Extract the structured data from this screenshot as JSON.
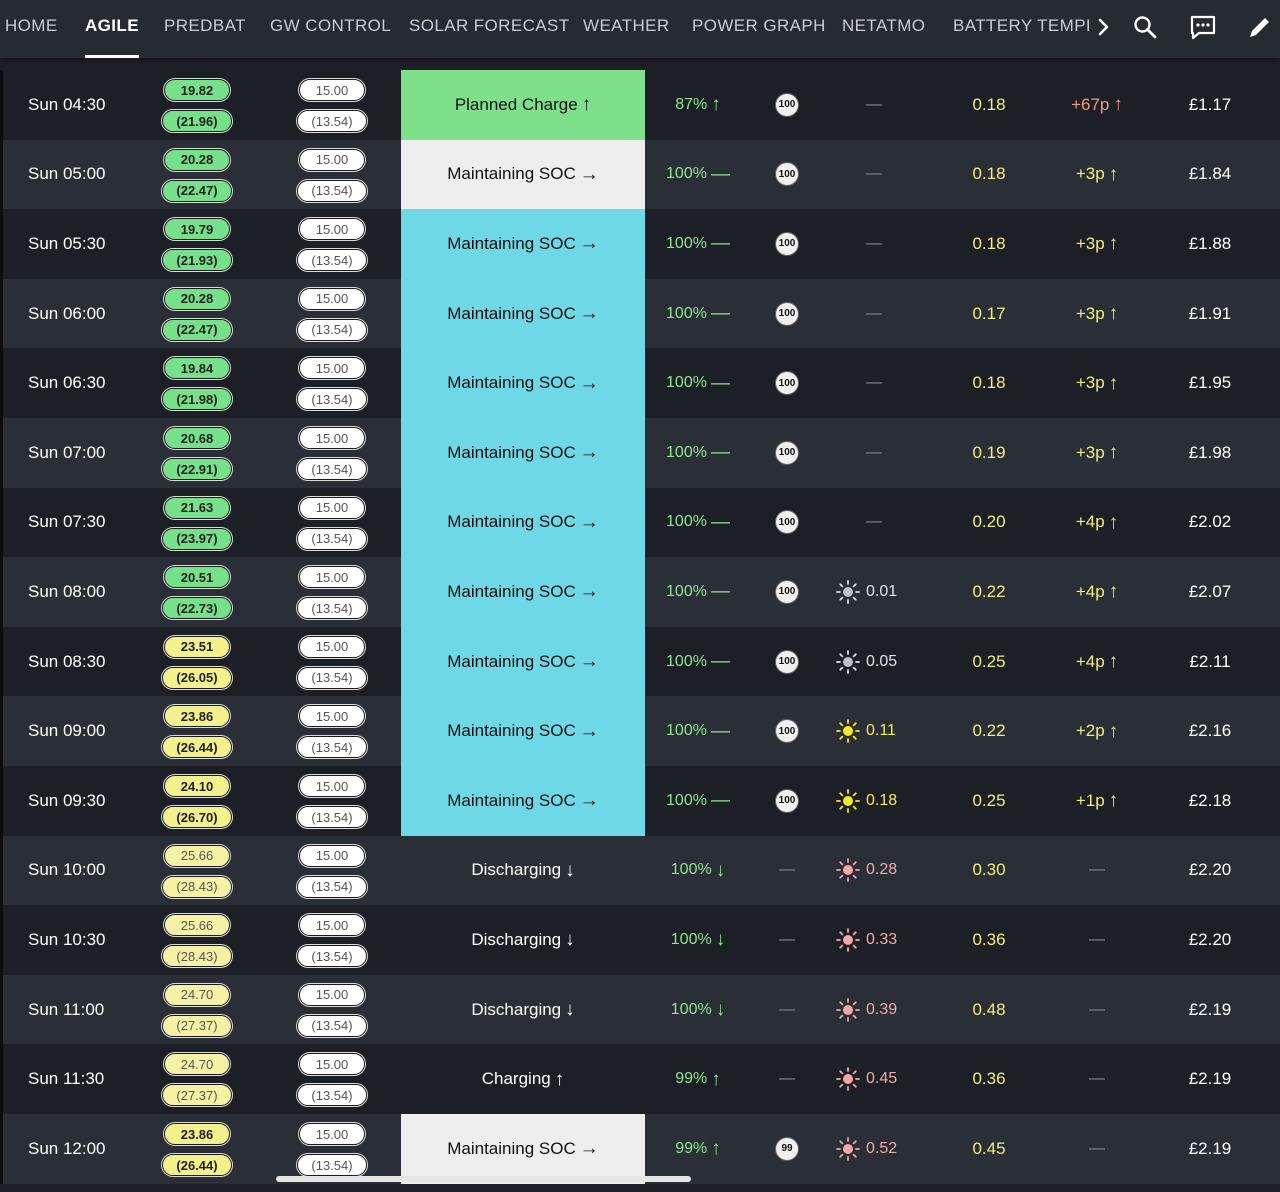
{
  "nav": {
    "tabs": [
      "HOME",
      "AGILE",
      "PREDBAT",
      "GW CONTROL",
      "SOLAR FORECAST",
      "WEATHER",
      "POWER GRAPH",
      "NETATMO",
      "BATTERY TEMPER"
    ],
    "active_tab": "AGILE",
    "icons": [
      "chevron-right-icon",
      "search-icon",
      "chat-icon",
      "edit-icon"
    ]
  },
  "colors": {
    "rate_green": "#77e08a",
    "rate_yellow": "#f3f08e",
    "state_planned": "#7fe08c",
    "state_maintain": "#6fd8e6",
    "soc_green": "#8ee68f",
    "load_yellow": "#f2ef7c",
    "cost_orange": "#f49a7a"
  },
  "rows": [
    {
      "time": "Sun 04:30",
      "rate": "19.82",
      "rate_alt": "(21.96)",
      "rate_color": "green",
      "export": "15.00",
      "export_alt": "(13.54)",
      "state": "Planned Charge",
      "state_arrow": "↑",
      "state_style": "planned",
      "soc": "87%",
      "soc_arrow": "↑",
      "soc_icon": "100",
      "pv": "",
      "pv_icon": "",
      "load": "0.18",
      "cost": "+67p",
      "cost_arrow": "↑",
      "cost_color": "orange",
      "total": "£1.17"
    },
    {
      "time": "Sun 05:00",
      "rate": "20.28",
      "rate_alt": "(22.47)",
      "rate_color": "green",
      "export": "15.00",
      "export_alt": "(13.54)",
      "state": "Maintaining SOC",
      "state_arrow": "→",
      "state_style": "white",
      "soc": "100%",
      "soc_arrow": "—",
      "soc_icon": "100",
      "pv": "",
      "pv_icon": "",
      "load": "0.18",
      "cost": "+3p",
      "cost_arrow": "↑",
      "cost_color": "yellow",
      "total": "£1.84"
    },
    {
      "time": "Sun 05:30",
      "rate": "19.79",
      "rate_alt": "(21.93)",
      "rate_color": "green",
      "export": "15.00",
      "export_alt": "(13.54)",
      "state": "Maintaining SOC",
      "state_arrow": "→",
      "state_style": "cyan",
      "soc": "100%",
      "soc_arrow": "—",
      "soc_icon": "100",
      "pv": "",
      "pv_icon": "",
      "load": "0.18",
      "cost": "+3p",
      "cost_arrow": "↑",
      "cost_color": "yellow",
      "total": "£1.88"
    },
    {
      "time": "Sun 06:00",
      "rate": "20.28",
      "rate_alt": "(22.47)",
      "rate_color": "green",
      "export": "15.00",
      "export_alt": "(13.54)",
      "state": "Maintaining SOC",
      "state_arrow": "→",
      "state_style": "cyan",
      "soc": "100%",
      "soc_arrow": "—",
      "soc_icon": "100",
      "pv": "",
      "pv_icon": "",
      "load": "0.17",
      "cost": "+3p",
      "cost_arrow": "↑",
      "cost_color": "yellow",
      "total": "£1.91"
    },
    {
      "time": "Sun 06:30",
      "rate": "19.84",
      "rate_alt": "(21.98)",
      "rate_color": "green",
      "export": "15.00",
      "export_alt": "(13.54)",
      "state": "Maintaining SOC",
      "state_arrow": "→",
      "state_style": "cyan",
      "soc": "100%",
      "soc_arrow": "—",
      "soc_icon": "100",
      "pv": "",
      "pv_icon": "",
      "load": "0.18",
      "cost": "+3p",
      "cost_arrow": "↑",
      "cost_color": "yellow",
      "total": "£1.95"
    },
    {
      "time": "Sun 07:00",
      "rate": "20.68",
      "rate_alt": "(22.91)",
      "rate_color": "green",
      "export": "15.00",
      "export_alt": "(13.54)",
      "state": "Maintaining SOC",
      "state_arrow": "→",
      "state_style": "cyan",
      "soc": "100%",
      "soc_arrow": "—",
      "soc_icon": "100",
      "pv": "",
      "pv_icon": "",
      "load": "0.19",
      "cost": "+3p",
      "cost_arrow": "↑",
      "cost_color": "yellow",
      "total": "£1.98"
    },
    {
      "time": "Sun 07:30",
      "rate": "21.63",
      "rate_alt": "(23.97)",
      "rate_color": "green",
      "export": "15.00",
      "export_alt": "(13.54)",
      "state": "Maintaining SOC",
      "state_arrow": "→",
      "state_style": "cyan",
      "soc": "100%",
      "soc_arrow": "—",
      "soc_icon": "100",
      "pv": "",
      "pv_icon": "",
      "load": "0.20",
      "cost": "+4p",
      "cost_arrow": "↑",
      "cost_color": "yellow",
      "total": "£2.02"
    },
    {
      "time": "Sun 08:00",
      "rate": "20.51",
      "rate_alt": "(22.73)",
      "rate_color": "green",
      "export": "15.00",
      "export_alt": "(13.54)",
      "state": "Maintaining SOC",
      "state_arrow": "→",
      "state_style": "cyan",
      "soc": "100%",
      "soc_arrow": "—",
      "soc_icon": "100",
      "pv": "0.01",
      "pv_icon": "sun-dim",
      "load": "0.22",
      "cost": "+4p",
      "cost_arrow": "↑",
      "cost_color": "yellow",
      "total": "£2.07"
    },
    {
      "time": "Sun 08:30",
      "rate": "23.51",
      "rate_alt": "(26.05)",
      "rate_color": "yellow",
      "export": "15.00",
      "export_alt": "(13.54)",
      "state": "Maintaining SOC",
      "state_arrow": "→",
      "state_style": "cyan",
      "soc": "100%",
      "soc_arrow": "—",
      "soc_icon": "100",
      "pv": "0.05",
      "pv_icon": "sun-dim",
      "load": "0.25",
      "cost": "+4p",
      "cost_arrow": "↑",
      "cost_color": "yellow",
      "total": "£2.11"
    },
    {
      "time": "Sun 09:00",
      "rate": "23.86",
      "rate_alt": "(26.44)",
      "rate_color": "yellow",
      "export": "15.00",
      "export_alt": "(13.54)",
      "state": "Maintaining SOC",
      "state_arrow": "→",
      "state_style": "cyan",
      "soc": "100%",
      "soc_arrow": "—",
      "soc_icon": "100",
      "pv": "0.11",
      "pv_icon": "sun-yellow",
      "load": "0.22",
      "cost": "+2p",
      "cost_arrow": "↑",
      "cost_color": "yellow",
      "total": "£2.16"
    },
    {
      "time": "Sun 09:30",
      "rate": "24.10",
      "rate_alt": "(26.70)",
      "rate_color": "yellow",
      "export": "15.00",
      "export_alt": "(13.54)",
      "state": "Maintaining SOC",
      "state_arrow": "→",
      "state_style": "cyan",
      "soc": "100%",
      "soc_arrow": "—",
      "soc_icon": "100",
      "pv": "0.18",
      "pv_icon": "sun-yellow",
      "load": "0.25",
      "cost": "+1p",
      "cost_arrow": "↑",
      "cost_color": "yellow",
      "total": "£2.18"
    },
    {
      "time": "Sun 10:00",
      "rate": "25.66",
      "rate_alt": "(28.43)",
      "rate_color": "yellowlight",
      "export": "15.00",
      "export_alt": "(13.54)",
      "state": "Discharging",
      "state_arrow": "↓",
      "state_style": "plain",
      "soc": "100%",
      "soc_arrow": "↓",
      "soc_icon": "",
      "pv": "0.28",
      "pv_icon": "sun-pink",
      "load": "0.30",
      "cost": "",
      "cost_arrow": "",
      "cost_color": "yellow",
      "total": "£2.20"
    },
    {
      "time": "Sun 10:30",
      "rate": "25.66",
      "rate_alt": "(28.43)",
      "rate_color": "yellowlight",
      "export": "15.00",
      "export_alt": "(13.54)",
      "state": "Discharging",
      "state_arrow": "↓",
      "state_style": "plain",
      "soc": "100%",
      "soc_arrow": "↓",
      "soc_icon": "",
      "pv": "0.33",
      "pv_icon": "sun-pink",
      "load": "0.36",
      "cost": "",
      "cost_arrow": "",
      "cost_color": "yellow",
      "total": "£2.20"
    },
    {
      "time": "Sun 11:00",
      "rate": "24.70",
      "rate_alt": "(27.37)",
      "rate_color": "yellowlight",
      "export": "15.00",
      "export_alt": "(13.54)",
      "state": "Discharging",
      "state_arrow": "↓",
      "state_style": "plain",
      "soc": "100%",
      "soc_arrow": "↓",
      "soc_icon": "",
      "pv": "0.39",
      "pv_icon": "sun-pink",
      "load": "0.48",
      "cost": "",
      "cost_arrow": "",
      "cost_color": "yellow",
      "total": "£2.19"
    },
    {
      "time": "Sun 11:30",
      "rate": "24.70",
      "rate_alt": "(27.37)",
      "rate_color": "yellowlight",
      "export": "15.00",
      "export_alt": "(13.54)",
      "state": "Charging",
      "state_arrow": "↑",
      "state_style": "plain",
      "soc": "99%",
      "soc_arrow": "↑",
      "soc_icon": "",
      "pv": "0.45",
      "pv_icon": "sun-pink",
      "load": "0.36",
      "cost": "",
      "cost_arrow": "",
      "cost_color": "yellow",
      "total": "£2.19"
    },
    {
      "time": "Sun 12:00",
      "rate": "23.86",
      "rate_alt": "(26.44)",
      "rate_color": "yellow",
      "export": "15.00",
      "export_alt": "(13.54)",
      "state": "Maintaining SOC",
      "state_arrow": "→",
      "state_style": "white",
      "soc": "99%",
      "soc_arrow": "↑",
      "soc_icon": "99",
      "pv": "0.52",
      "pv_icon": "sun-pink",
      "load": "0.45",
      "cost": "",
      "cost_arrow": "",
      "cost_color": "yellow",
      "total": "£2.19"
    }
  ]
}
